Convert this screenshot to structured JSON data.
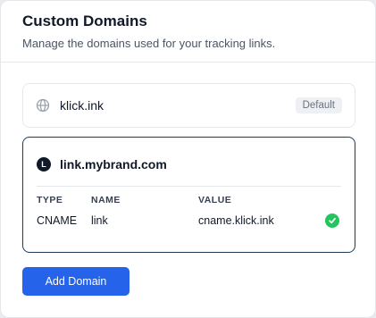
{
  "header": {
    "title": "Custom Domains",
    "subtitle": "Manage the domains used for your tracking links."
  },
  "domains": [
    {
      "name": "klick.ink",
      "badge": "Default",
      "icon": "globe-icon"
    },
    {
      "name": "link.mybrand.com",
      "logo_letter": "L",
      "dns": {
        "columns": [
          "TYPE",
          "NAME",
          "VALUE"
        ],
        "record": {
          "type": "CNAME",
          "name": "link",
          "value": "cname.klick.ink",
          "status_icon": "check-circle-icon"
        }
      }
    }
  ],
  "actions": {
    "add_label": "Add Domain"
  },
  "colors": {
    "accent": "#2563eb",
    "success": "#22c55e",
    "selected_border": "#1f3b57"
  }
}
